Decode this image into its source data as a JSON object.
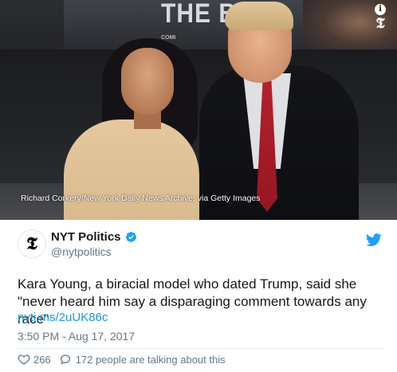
{
  "photo": {
    "poster_title": "THE BOX",
    "poster_sub": "COMI",
    "caption": "Richard Corkery/New York Daily News Archive, via Getty Images",
    "info_icon": "info-icon",
    "corner_logo": "𝕿"
  },
  "tweet": {
    "avatar_glyph": "𝕿",
    "display_name": "NYT Politics",
    "handle": "@nytpolitics",
    "text": "Kara Young, a biracial model who dated Trump, said she \"never heard him say a disparaging comment towards any race\"",
    "link": "nyti.ms/2uUK86c",
    "timestamp": "3:50 PM - Aug 17, 2017",
    "likes": "266",
    "talking": "172 people are talking about this"
  },
  "colors": {
    "link": "#1b95e0",
    "secondary_text": "#657786",
    "verified": "#1da1f2",
    "tie": "#b8202c"
  },
  "icons": [
    "verified-badge-icon",
    "twitter-bird-icon",
    "heart-icon",
    "reply-bubble-icon",
    "info-icon",
    "nyt-logo-icon"
  ]
}
